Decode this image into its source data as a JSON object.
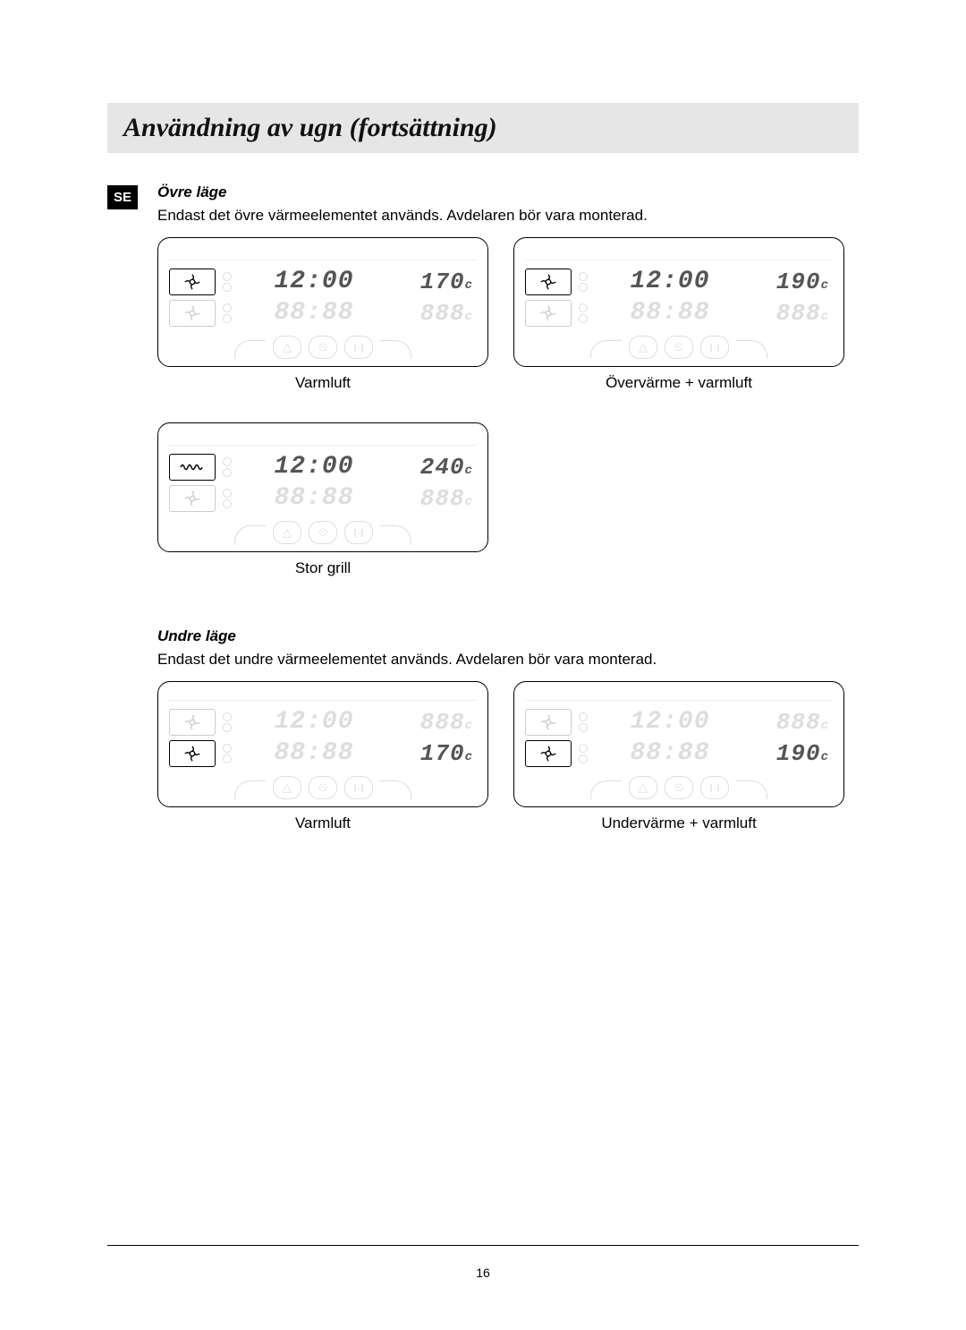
{
  "page_number": "16",
  "header": {
    "title": "Användning av ugn (fortsättning)"
  },
  "lang_badge": "SE",
  "sections": {
    "upper": {
      "heading": "Övre läge",
      "desc": "Endast det övre värmeelementet används. Avdelaren bör vara monterad.",
      "panels": [
        {
          "mode_icon": "fan",
          "time_active": "12:00",
          "temp_active": "170",
          "temp_unit": "c",
          "time_dim": "88:88",
          "temp_dim": "888",
          "caption": "Varmluft"
        },
        {
          "mode_icon": "fan",
          "time_active": "12:00",
          "temp_active": "190",
          "temp_unit": "c",
          "time_dim": "88:88",
          "temp_dim": "888",
          "caption": "Övervärme + varmluft"
        },
        {
          "mode_icon": "grill",
          "time_active": "12:00",
          "temp_active": "240",
          "temp_unit": "c",
          "time_dim": "88:88",
          "temp_dim": "888",
          "caption": "Stor grill"
        }
      ]
    },
    "lower": {
      "heading": "Undre läge",
      "desc": "Endast det undre värmeelementet används. Avdelaren bör vara monterad.",
      "panels": [
        {
          "mode_icon": "fan",
          "time_active": "12:00",
          "temp_active": "170",
          "temp_unit": "c",
          "time_dim": "88:88",
          "temp_dim": "888",
          "caption": "Varmluft"
        },
        {
          "mode_icon": "fan",
          "time_active": "12:00",
          "temp_active": "190",
          "temp_unit": "c",
          "time_dim": "88:88",
          "temp_dim": "888",
          "caption": "Undervärme + varmluft"
        }
      ]
    }
  },
  "ghost_buttons": [
    "△",
    "⏲",
    "I·I"
  ]
}
